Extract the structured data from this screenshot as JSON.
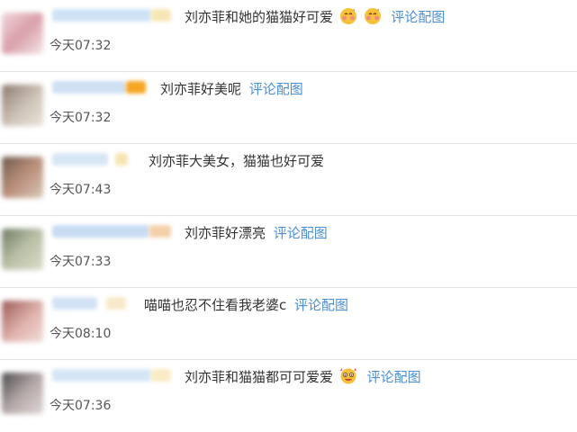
{
  "comments": [
    {
      "text": "刘亦菲和她的猫猫好可爱",
      "emojis": [
        "blushing-kiss-emoji",
        "blushing-kiss-emoji"
      ],
      "link": "评论配图",
      "time": "今天07:32",
      "avatar_colors": [
        "#f2d6da",
        "#d9a0aa"
      ],
      "name_colors": [
        "#cfe3f6",
        "#f6e2a8"
      ]
    },
    {
      "text": "刘亦菲好美呢",
      "emojis": [],
      "link": "评论配图",
      "time": "今天07:32",
      "avatar_colors": [
        "#8a7a6e",
        "#cfc4b8"
      ],
      "name_colors": [
        "#cfe0f3",
        "#f5a623"
      ]
    },
    {
      "text": "刘亦菲大美女，猫猫也好可爱",
      "emojis": [],
      "link": "",
      "time": "今天07:43",
      "avatar_colors": [
        "#6f5a4d",
        "#b98f7a"
      ],
      "name_colors": [
        "#d7e6f5",
        "#f4e0a6"
      ]
    },
    {
      "text": "刘亦菲好漂亮",
      "emojis": [],
      "link": "评论配图",
      "time": "今天07:33",
      "avatar_colors": [
        "#6e7b64",
        "#b9c0a6"
      ],
      "name_colors": [
        "#c8dcf3",
        "#f3c89a"
      ]
    },
    {
      "text": "喵喵也忍不住看我老婆c",
      "emojis": [],
      "link": "评论配图",
      "time": "今天08:10",
      "avatar_colors": [
        "#9a5a55",
        "#e0b3ad"
      ],
      "name_colors": [
        "#d3e3f5",
        "#f6e6c0"
      ]
    },
    {
      "text": "刘亦菲和猫猫都可可爱爱",
      "emojis": [
        "sparkle-face-emoji"
      ],
      "link": "评论配图",
      "time": "今天07:36",
      "avatar_colors": [
        "#4a4a4a",
        "#b3a6a6"
      ],
      "name_colors": [
        "#d6e6f6",
        "#f8e8b8"
      ]
    }
  ]
}
